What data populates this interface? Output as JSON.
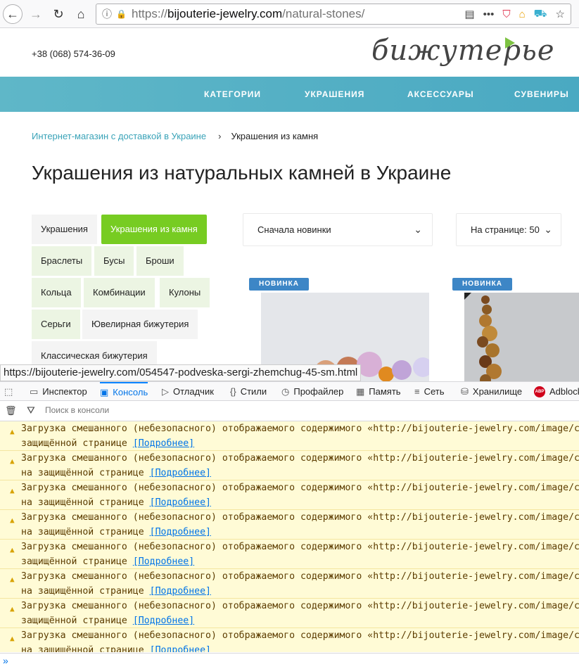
{
  "browser": {
    "url_domain": "bijouterie-jewelry.com",
    "url_prefix": "https://",
    "url_path": "/natural-stones/"
  },
  "header": {
    "phone": "+38 (068) 574-36-09",
    "logo_text": "бижутерье"
  },
  "nav": {
    "items": [
      "КАТЕГОРИИ",
      "УКРАШЕНИЯ",
      "АКСЕССУАРЫ",
      "СУВЕНИРЫ"
    ]
  },
  "breadcrumb": {
    "home": "Интернет-магазин с доставкой в Украине",
    "separator": "›",
    "current": "Украшения из камня"
  },
  "page": {
    "title": "Украшения из натуральных камней в Украине"
  },
  "categories": [
    {
      "label": "Украшения",
      "state": "plain"
    },
    {
      "label": "Украшения из камня",
      "state": "active"
    },
    {
      "label": "Браслеты",
      "state": "normal"
    },
    {
      "label": "Бусы",
      "state": "normal"
    },
    {
      "label": "Броши",
      "state": "normal"
    },
    {
      "label": "Кольца",
      "state": "normal"
    },
    {
      "label": "Комбинации",
      "state": "normal"
    },
    {
      "label": "Кулоны",
      "state": "normal"
    },
    {
      "label": "Серьги",
      "state": "normal"
    },
    {
      "label": "Ювелирная бижутерия",
      "state": "plain"
    },
    {
      "label": "Классическая бижутерия",
      "state": "plain"
    }
  ],
  "sort": {
    "selected": "Сначала новинки"
  },
  "per_page": {
    "selected": "На странице: 50"
  },
  "products": [
    {
      "badge": "НОВИНКА"
    },
    {
      "badge": "НОВИНКА"
    }
  ],
  "status_url": "https://bijouterie-jewelry.com/054547-podveska-sergi-zhemchug-45-sm.html",
  "devtools": {
    "tabs": [
      "Инспектор",
      "Консоль",
      "Отладчик",
      "Стили",
      "Профайлер",
      "Память",
      "Сеть",
      "Хранилище",
      "Adblock"
    ],
    "active_tab": "Консоль",
    "filter_placeholder": "Поиск в консоли",
    "messages": [
      {
        "line1": "Загрузка смешанного (небезопасного) отображаемого содержимого «http://bijouterie-jewelry.com/image/c",
        "line2": "защищённой странице",
        "link": "[Подробнее]"
      },
      {
        "line1": "Загрузка смешанного (небезопасного) отображаемого содержимого «http://bijouterie-jewelry.com/image/c",
        "line2": "на защищённой странице",
        "link": "[Подробнее]"
      },
      {
        "line1": "Загрузка смешанного (небезопасного) отображаемого содержимого «http://bijouterie-jewelry.com/image/c",
        "line2": "на защищённой странице",
        "link": "[Подробнее]"
      },
      {
        "line1": "Загрузка смешанного (небезопасного) отображаемого содержимого «http://bijouterie-jewelry.com/image/c",
        "line2": "на защищённой странице",
        "link": "[Подробнее]"
      },
      {
        "line1": "Загрузка смешанного (небезопасного) отображаемого содержимого «http://bijouterie-jewelry.com/image/c",
        "line2": "защищённой странице",
        "link": "[Подробнее]"
      },
      {
        "line1": "Загрузка смешанного (небезопасного) отображаемого содержимого «http://bijouterie-jewelry.com/image/c",
        "line2": "на защищённой странице",
        "link": "[Подробнее]"
      },
      {
        "line1": "Загрузка смешанного (небезопасного) отображаемого содержимого «http://bijouterie-jewelry.com/image/c",
        "line2": "защищённой странице",
        "link": "[Подробнее]"
      },
      {
        "line1": "Загрузка смешанного (небезопасного) отображаемого содержимого «http://bijouterie-jewelry.com/image/c",
        "line2": "на защищённой странице",
        "link": "[Подробнее]"
      }
    ],
    "prompt": "»"
  },
  "colors": {
    "nav_bg": "#4aa9c2",
    "active_category": "#77cc22",
    "category_bg": "#ecf5e3",
    "badge": "#3d86c6",
    "console_warning_bg": "#fffbd6",
    "link": "#0074e8"
  }
}
